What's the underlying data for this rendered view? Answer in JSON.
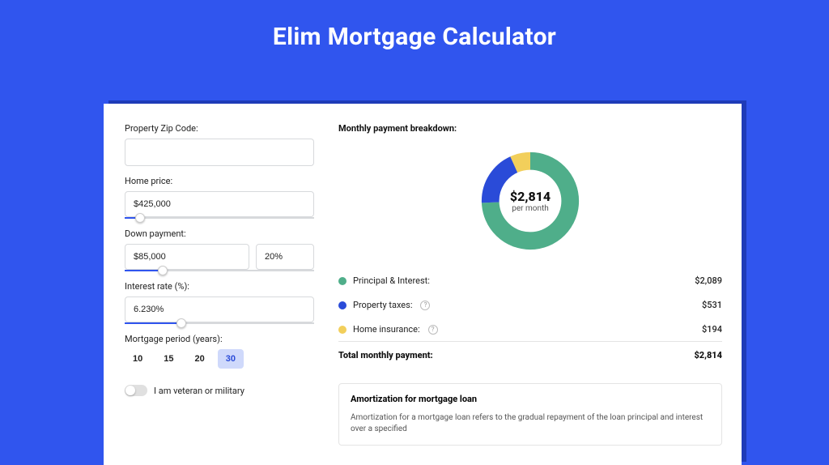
{
  "page": {
    "title": "Elim Mortgage Calculator"
  },
  "form": {
    "zip_label": "Property Zip Code:",
    "zip_value": "",
    "home_price_label": "Home price:",
    "home_price_value": "$425,000",
    "home_price_slider_pct": 8,
    "down_payment_label": "Down payment:",
    "down_payment_value": "$85,000",
    "down_payment_pct_value": "20%",
    "down_payment_slider_pct": 20,
    "interest_label": "Interest rate (%):",
    "interest_value": "6.230%",
    "interest_slider_pct": 30,
    "period_label": "Mortgage period (years):",
    "period_options": [
      "10",
      "15",
      "20",
      "30"
    ],
    "period_selected": "30",
    "veteran_label": "I am veteran or military",
    "veteran_on": false
  },
  "breakdown": {
    "title": "Monthly payment breakdown:",
    "center_amount": "$2,814",
    "center_sub": "per month",
    "items": [
      {
        "label": "Principal & Interest:",
        "amount": "$2,089",
        "color": "#4fae8a",
        "help": false,
        "value": 2089
      },
      {
        "label": "Property taxes:",
        "amount": "$531",
        "color": "#2a4bd8",
        "help": true,
        "value": 531
      },
      {
        "label": "Home insurance:",
        "amount": "$194",
        "color": "#f2cf5b",
        "help": true,
        "value": 194
      }
    ],
    "total_label": "Total monthly payment:",
    "total_amount": "$2,814"
  },
  "amortization": {
    "title": "Amortization for mortgage loan",
    "text": "Amortization for a mortgage loan refers to the gradual repayment of the loan principal and interest over a specified"
  },
  "chart_data": {
    "type": "pie",
    "title": "Monthly payment breakdown",
    "series": [
      {
        "name": "Principal & Interest",
        "value": 2089,
        "color": "#4fae8a"
      },
      {
        "name": "Property taxes",
        "value": 531,
        "color": "#2a4bd8"
      },
      {
        "name": "Home insurance",
        "value": 194,
        "color": "#f2cf5b"
      }
    ],
    "total": 2814,
    "center_label": "$2,814 per month"
  }
}
